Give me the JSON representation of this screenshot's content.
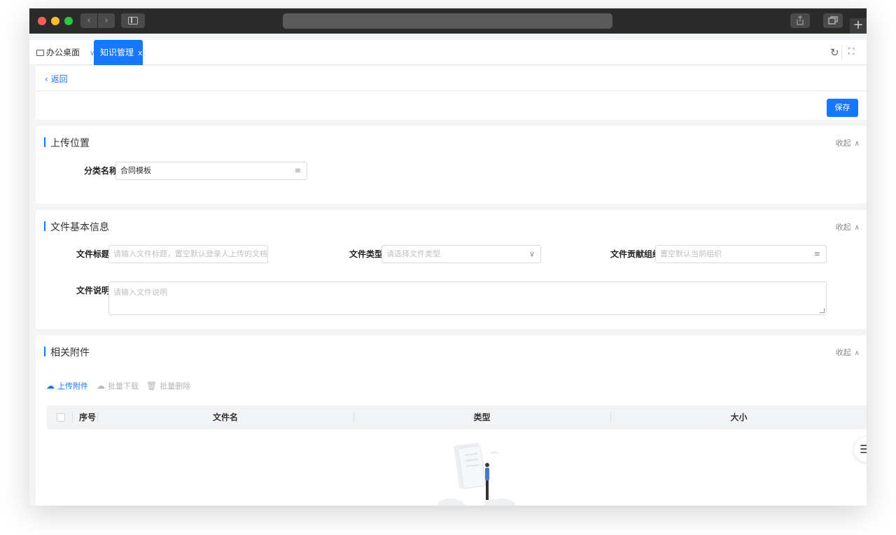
{
  "browser": {
    "nav_back": "‹",
    "nav_forward": "›",
    "new_tab": "+"
  },
  "tabs": {
    "home": "办公桌面",
    "active": "知识管理",
    "close": "x"
  },
  "toolbar": {
    "back_label": "返回",
    "save_label": "保存"
  },
  "upload_location": {
    "title": "上传位置",
    "collapse": "收起",
    "category_label": "分类名称:",
    "category_value": "合同模板"
  },
  "file_info": {
    "title": "文件基本信息",
    "collapse": "收起",
    "title_label": "文件标题:",
    "title_placeholder": "请输入文件标题，置空默认登录人上传的文档",
    "type_label": "文件类型:",
    "type_placeholder": "请选择文件类型",
    "org_label": "文件贡献组织:",
    "org_placeholder": "置空默认当前组织",
    "desc_label": "文件说明:",
    "desc_placeholder": "请输入文件说明"
  },
  "attachments": {
    "title": "相关附件",
    "collapse": "收起",
    "upload": "上传附件",
    "batch_download": "批量下载",
    "batch_delete": "批量删除",
    "columns": [
      "序号",
      "文件名",
      "类型",
      "大小"
    ]
  },
  "colors": {
    "primary": "#1677ff",
    "background": "#f3f4f6"
  }
}
